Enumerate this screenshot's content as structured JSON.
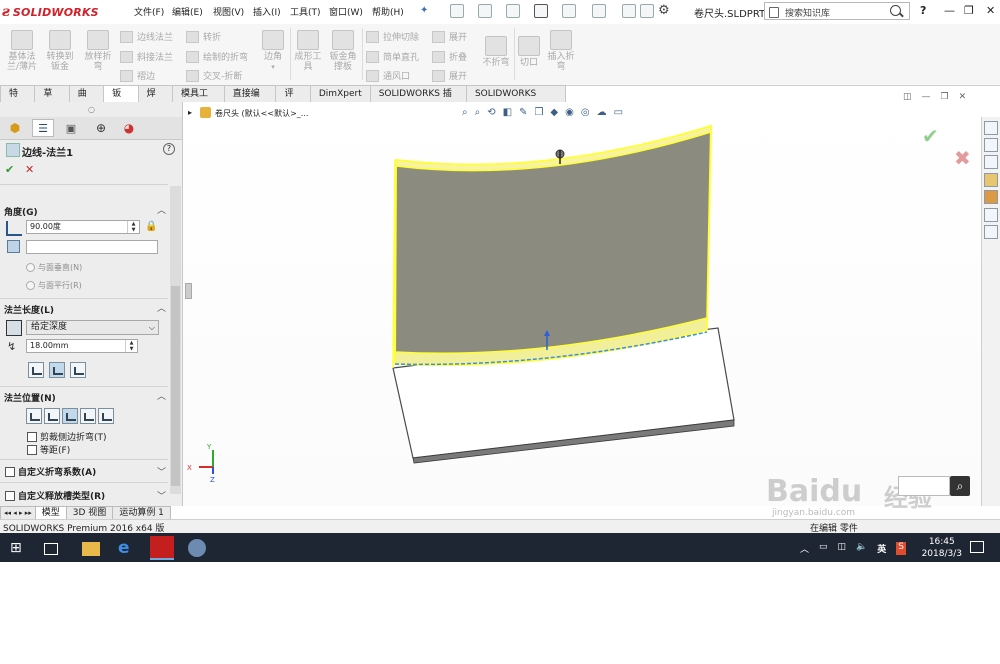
{
  "app": {
    "brand": "SOLIDWORKS",
    "document_title": "卷尺头.SLDPRT *",
    "search_placeholder": "搜索知识库",
    "accent": "#d21f28"
  },
  "menu": [
    "文件(F)",
    "编辑(E)",
    "视图(V)",
    "插入(I)",
    "工具(T)",
    "窗口(W)",
    "帮助(H)"
  ],
  "window_controls": [
    "?",
    "—",
    "❐",
    "✕"
  ],
  "ribbon": {
    "big": [
      {
        "label": "基体法\n兰/薄片"
      },
      {
        "label": "转换到\n钣金"
      },
      {
        "label": "放样折\n弯"
      },
      {
        "label": "边角"
      },
      {
        "label": "成形工\n具"
      },
      {
        "label": "钣金角\n撑板"
      },
      {
        "label": "不折弯"
      },
      {
        "label": "切口"
      },
      {
        "label": "插入折\n弯"
      }
    ],
    "small": [
      "边线法兰",
      "斜接法兰",
      "褶边",
      "转折",
      "绘制的折弯",
      "交叉-折断",
      "拉伸切除",
      "简单直孔",
      "通风口",
      "展开",
      "折叠",
      "展开"
    ]
  },
  "tabs": [
    "特征",
    "草图",
    "曲面",
    "钣金",
    "焊件",
    "模具工具",
    "直接编辑",
    "评估",
    "DimXpert",
    "SOLIDWORKS 插件",
    "SOLIDWORKS MBD"
  ],
  "active_tab": "钣金",
  "panel": {
    "title": "边线-法兰1",
    "ok": "✔",
    "cancel": "✕",
    "angle_section": "角度(G)",
    "angle_value": "90.00度",
    "radio_perp": "与面垂直(N)",
    "radio_parallel": "与面平行(R)",
    "length_section": "法兰长度(L)",
    "length_type": "给定深度",
    "length_value": "18.00mm",
    "position_section": "法兰位置(N)",
    "trim_side": "剪裁侧边折弯(T)",
    "offset": "等距(F)",
    "custom_bend": "自定义折弯系数(A)",
    "custom_relief": "自定义释放槽类型(R)"
  },
  "tree_item": "卷尺头 (默认<<默认>_...",
  "bottom_tabs": [
    "模型",
    "3D 视图",
    "运动算例 1"
  ],
  "status": {
    "left": "SOLIDWORKS Premium 2016 x64 版",
    "right": "在编辑 零件"
  },
  "taskbar": {
    "time": "16:45",
    "date": "2018/3/3",
    "ime": "英"
  },
  "watermark": {
    "brand": "Baidu",
    "suffix": "经验",
    "url": "jingyan.baidu.com"
  },
  "colors": {
    "flange_fill": "#8c8b80",
    "edge_highlight": "#ffff33",
    "taskbar": "#1f2633"
  }
}
